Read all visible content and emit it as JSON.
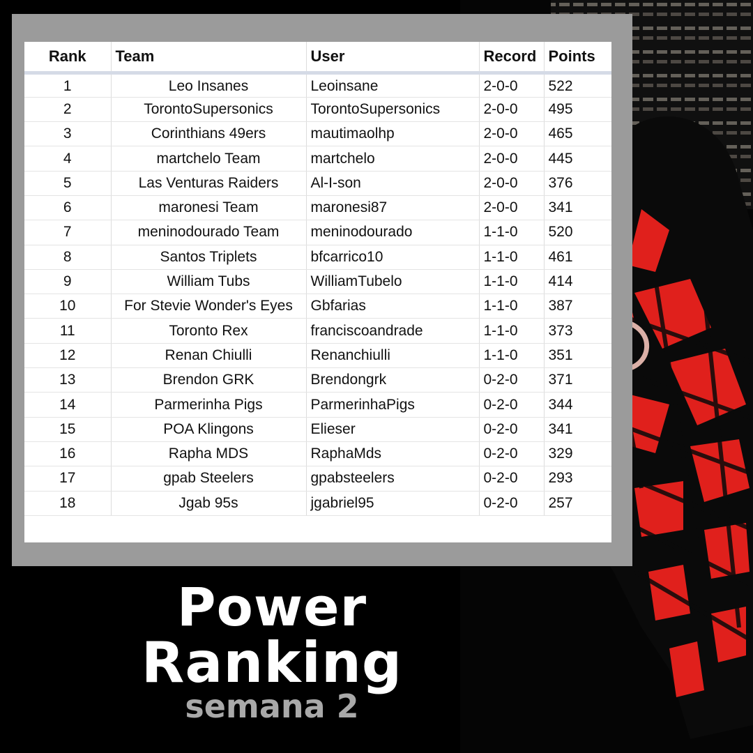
{
  "headers": {
    "rank": "Rank",
    "team": "Team",
    "user": "User",
    "record": "Record",
    "points": "Points"
  },
  "rows": [
    {
      "rank": "1",
      "team": "Leo Insanes",
      "user": "Leoinsane",
      "record": "2-0-0",
      "points": "522"
    },
    {
      "rank": "2",
      "team": "TorontoSupersonics",
      "user": "TorontoSupersonics",
      "record": "2-0-0",
      "points": "495"
    },
    {
      "rank": "3",
      "team": "Corinthians 49ers",
      "user": "mautimaolhp",
      "record": "2-0-0",
      "points": "465"
    },
    {
      "rank": "4",
      "team": "martchelo Team",
      "user": "martchelo",
      "record": "2-0-0",
      "points": "445"
    },
    {
      "rank": "5",
      "team": "Las Venturas Raiders",
      "user": "Al-I-son",
      "record": "2-0-0",
      "points": "376"
    },
    {
      "rank": "6",
      "team": "maronesi Team",
      "user": "maronesi87",
      "record": "2-0-0",
      "points": "341"
    },
    {
      "rank": "7",
      "team": "meninodourado Team",
      "user": "meninodourado",
      "record": "1-1-0",
      "points": "520"
    },
    {
      "rank": "8",
      "team": "Santos Triplets",
      "user": "bfcarrico10",
      "record": "1-1-0",
      "points": "461"
    },
    {
      "rank": "9",
      "team": "William Tubs",
      "user": "WilliamTubelo",
      "record": "1-1-0",
      "points": "414"
    },
    {
      "rank": "10",
      "team": "For Stevie Wonder's Eyes",
      "user": "Gbfarias",
      "record": "1-1-0",
      "points": "387"
    },
    {
      "rank": "11",
      "team": "Toronto Rex",
      "user": "franciscoandrade",
      "record": "1-1-0",
      "points": "373"
    },
    {
      "rank": "12",
      "team": "Renan Chiulli",
      "user": "Renanchiulli",
      "record": "1-1-0",
      "points": "351"
    },
    {
      "rank": "13",
      "team": "Brendon GRK",
      "user": "Brendongrk",
      "record": "0-2-0",
      "points": "371"
    },
    {
      "rank": "14",
      "team": "Parmerinha Pigs",
      "user": "ParmerinhaPigs",
      "record": "0-2-0",
      "points": "344"
    },
    {
      "rank": "15",
      "team": "POA Klingons",
      "user": "Elieser",
      "record": "0-2-0",
      "points": "341"
    },
    {
      "rank": "16",
      "team": "Rapha MDS",
      "user": "RaphaMds",
      "record": "0-2-0",
      "points": "329"
    },
    {
      "rank": "17",
      "team": "gpab Steelers",
      "user": "gpabsteelers",
      "record": "0-2-0",
      "points": "293"
    },
    {
      "rank": "18",
      "team": "Jgab 95s",
      "user": "jgabriel95",
      "record": "0-2-0",
      "points": "257"
    }
  ],
  "title": {
    "line1": "Power",
    "line2": "Ranking",
    "line3": "semana 2"
  },
  "colors": {
    "background": "#000000",
    "frame": "#9b9b9b",
    "art_red": "#e0201c",
    "subtitle": "#a9a9a9"
  }
}
